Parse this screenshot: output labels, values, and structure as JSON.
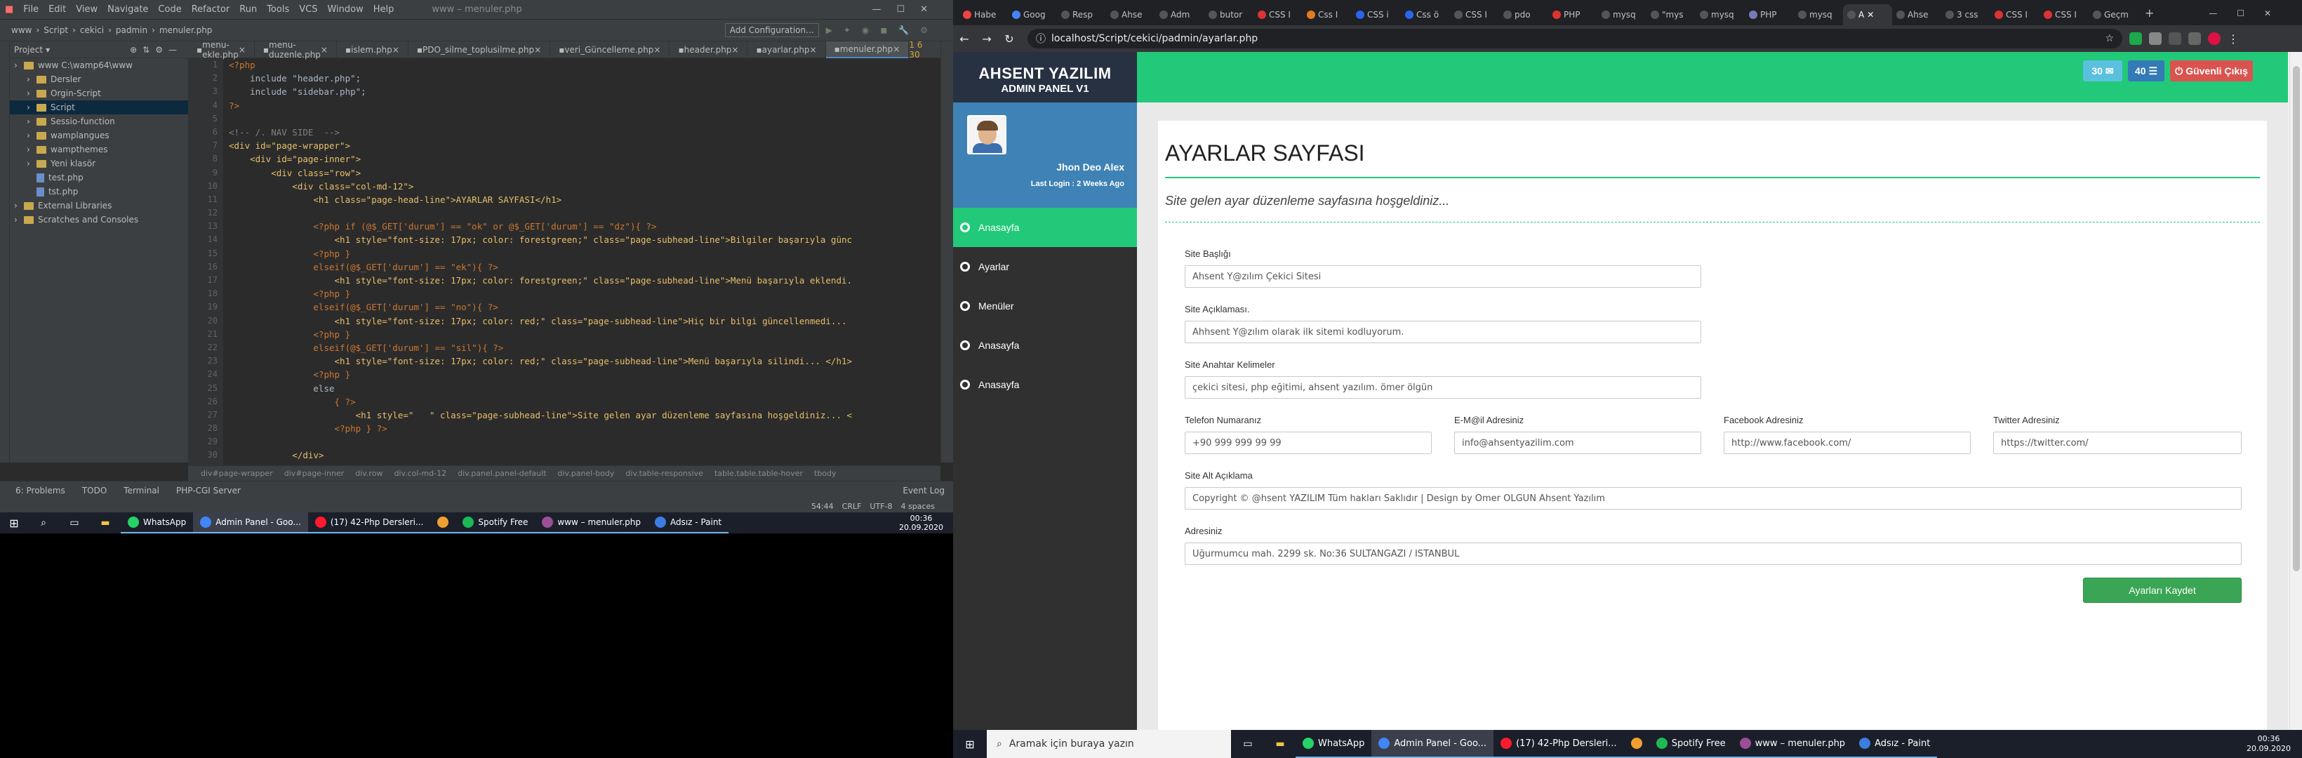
{
  "ide": {
    "menu": [
      "File",
      "Edit",
      "View",
      "Navigate",
      "Code",
      "Refactor",
      "Run",
      "Tools",
      "VCS",
      "Window",
      "Help"
    ],
    "window_title": "www – menuler.php",
    "add_config": "Add Configuration...",
    "breadcrumb": [
      "www",
      "Script",
      "cekici",
      "padmin",
      "menuler.php"
    ],
    "project_label": "Project",
    "project_tree": [
      {
        "label": "www  C:\\wamp64\\www",
        "indent": 0,
        "type": "folder",
        "selected": false
      },
      {
        "label": "Dersler",
        "indent": 1,
        "type": "folder",
        "selected": false
      },
      {
        "label": "Orgin-Script",
        "indent": 1,
        "type": "folder",
        "selected": false
      },
      {
        "label": "Script",
        "indent": 1,
        "type": "folder",
        "selected": true
      },
      {
        "label": "Sessio-function",
        "indent": 1,
        "type": "folder",
        "selected": false
      },
      {
        "label": "wamplangues",
        "indent": 1,
        "type": "folder",
        "selected": false
      },
      {
        "label": "wampthemes",
        "indent": 1,
        "type": "folder",
        "selected": false
      },
      {
        "label": "Yeni klasör",
        "indent": 1,
        "type": "folder",
        "selected": false
      },
      {
        "label": "test.php",
        "indent": 1,
        "type": "file",
        "selected": false
      },
      {
        "label": "tst.php",
        "indent": 1,
        "type": "file",
        "selected": false
      },
      {
        "label": "External Libraries",
        "indent": 0,
        "type": "folder",
        "selected": false
      },
      {
        "label": "Scratches and Consoles",
        "indent": 0,
        "type": "folder",
        "selected": false
      }
    ],
    "tabs": [
      {
        "label": "menu-ekle.php",
        "active": false
      },
      {
        "label": "menu-duzenle.php",
        "active": false
      },
      {
        "label": "islem.php",
        "active": false
      },
      {
        "label": "PDO_silme_toplusilme.php",
        "active": false
      },
      {
        "label": "veri_Güncelleme.php",
        "active": false
      },
      {
        "label": "header.php",
        "active": false
      },
      {
        "label": "ayarlar.php",
        "active": false
      },
      {
        "label": "menuler.php",
        "active": true
      }
    ],
    "inspection_summary": "1  6  30",
    "code_lines": [
      "<?php",
      "    include \"header.php\";",
      "    include \"sidebar.php\";",
      "?>",
      "",
      "<!-- /. NAV SIDE  -->",
      "<div id=\"page-wrapper\">",
      "    <div id=\"page-inner\">",
      "        <div class=\"row\">",
      "            <div class=\"col-md-12\">",
      "                <h1 class=\"page-head-line\">AYARLAR SAYFASI</h1>",
      "",
      "                <?php if (@$_GET['durum'] == \"ok\" or @$_GET['durum'] == \"dz\"){ ?>",
      "                    <h1 style=\"font-size: 17px; color: forestgreen;\" class=\"page-subhead-line\">Bilgiler başarıyla günc",
      "                <?php }",
      "                elseif(@$_GET['durum'] == \"ek\"){ ?>",
      "                    <h1 style=\"font-size: 17px; color: forestgreen;\" class=\"page-subhead-line\">Menü başarıyla eklendi.",
      "                <?php }",
      "                elseif(@$_GET['durum'] == \"no\"){ ?>",
      "                    <h1 style=\"font-size: 17px; color: red;\" class=\"page-subhead-line\">Hiç bir bilgi güncellenmedi...",
      "                <?php }",
      "                elseif(@$_GET['durum'] == \"sil\"){ ?>",
      "                    <h1 style=\"font-size: 17px; color: red;\" class=\"page-subhead-line\">Menü başarıyla silindi... </h1>",
      "                <?php }",
      "                else",
      "                    { ?>",
      "                        <h1 style=\"   \" class=\"page-subhead-line\">Site gelen ayar düzenleme sayfasına hoşgeldiniz... <",
      "                    <?php } ?>",
      "",
      "            </div>"
    ],
    "html_crumbs": [
      "div#page-wrapper",
      "div#page-inner",
      "div.row",
      "div.col-md-12",
      "div.panel.panel-default",
      "div.panel-body",
      "div.table-responsive",
      "table.table.table-hover",
      "tbody"
    ],
    "toolbar": [
      "6: Problems",
      "TODO",
      "Terminal",
      "PHP-CGI Server",
      "Event Log"
    ],
    "status": [
      "54:44",
      "CRLF",
      "UTF-8",
      "4 spaces"
    ]
  },
  "taskbar_left": {
    "apps": [
      {
        "label": "WhatsApp",
        "color": "#25d366",
        "active": false
      },
      {
        "label": "Admin Panel - Goo...",
        "color": "#4285f4",
        "active": true
      },
      {
        "label": "(17) 42-Php Dersleri...",
        "color": "#ff1b2d",
        "active": false
      },
      {
        "label": "",
        "color": "#f0a030",
        "active": false
      },
      {
        "label": "Spotify Free",
        "color": "#1db954",
        "active": false
      },
      {
        "label": "www – menuler.php",
        "color": "#9b4f96",
        "active": false
      },
      {
        "label": "Adsız - Paint",
        "color": "#3d7ce0",
        "active": false
      }
    ],
    "time": "00:36",
    "date": "20.09.2020"
  },
  "browser": {
    "tabs": [
      {
        "label": "Habe",
        "color": "#e44"
      },
      {
        "label": "Goog",
        "color": "#4285f4"
      },
      {
        "label": "Resp",
        "color": "#555"
      },
      {
        "label": "Ahse",
        "color": "#555"
      },
      {
        "label": "Adm",
        "color": "#555"
      },
      {
        "label": "butor",
        "color": "#555"
      },
      {
        "label": "CSS I",
        "color": "#d33"
      },
      {
        "label": "Css I",
        "color": "#e57b20"
      },
      {
        "label": "CSS i",
        "color": "#2965f1"
      },
      {
        "label": "Css ö",
        "color": "#2965f1"
      },
      {
        "label": "CSS I",
        "color": "#555"
      },
      {
        "label": "pdo",
        "color": "#555"
      },
      {
        "label": "PHP",
        "color": "#d33"
      },
      {
        "label": "mysq",
        "color": "#555"
      },
      {
        "label": "\"mys",
        "color": "#555"
      },
      {
        "label": "mysq",
        "color": "#555"
      },
      {
        "label": "PHP",
        "color": "#777bb4"
      },
      {
        "label": "mysq",
        "color": "#555"
      },
      {
        "label": "A",
        "color": "#555",
        "active": true
      },
      {
        "label": "Ahse",
        "color": "#555"
      },
      {
        "label": "3 css",
        "color": "#555"
      },
      {
        "label": "CSS I",
        "color": "#d33"
      },
      {
        "label": "CSS I",
        "color": "#d33"
      },
      {
        "label": "Geçm",
        "color": "#555"
      }
    ],
    "url": "localhost/Script/cekici/padmin/ayarlar.php"
  },
  "admin": {
    "brand": "AHSENT YAZILIM",
    "brand_sub": "ADMIN PANEL V1",
    "header_buttons": {
      "messages": "30",
      "tasks": "40",
      "logout": "Güvenli Çıkış"
    },
    "user_name": "Jhon Deo Alex",
    "last_login": "Last Login : 2 Weeks Ago",
    "menu": [
      {
        "label": "Anasayfa",
        "active": true
      },
      {
        "label": "Ayarlar",
        "active": false
      },
      {
        "label": "Menüler",
        "active": false
      },
      {
        "label": "Anasayfa",
        "active": false
      },
      {
        "label": "Anasayfa",
        "active": false
      }
    ],
    "page_title": "AYARLAR SAYFASI",
    "subhead": "Site gelen ayar düzenleme sayfasına hoşgeldiniz...",
    "form": {
      "site_title": {
        "label": "Site Başlığı",
        "value": "Ahsent Y@zılım Çekici Sitesi"
      },
      "site_desc": {
        "label": "Site Açıklaması.",
        "value": "Ahhsent Y@zılım olarak ilk sitemi kodluyorum."
      },
      "site_keywords": {
        "label": "Site Anahtar Kelimeler",
        "value": "çekici sitesi, php eğitimi, ahsent yazılım. ömer ölgün"
      },
      "phone": {
        "label": "Telefon Numaranız",
        "value": "+90 999 999 99 99"
      },
      "email": {
        "label": "E-M@il Adresiniz",
        "value": "info@ahsentyazilim.com"
      },
      "facebook": {
        "label": "Facebook Adresiniz",
        "value": "http://www.facebook.com/"
      },
      "twitter": {
        "label": "Twitter Adresiniz",
        "value": "https://twitter.com/"
      },
      "footer_desc": {
        "label": "Site Alt Açıklama",
        "value": "Copyright © @hsent YAZILIM Tüm hakları Saklıdır | Design by Ömer OLGÜN Ahsent Yazılım"
      },
      "address": {
        "label": "Adresiniz",
        "value": "Uğurmumcu mah. 2299 sk. No:36 SULTANGAZİ / İSTANBUL"
      },
      "save_label": "Ayarları Kaydet"
    }
  },
  "taskbar_right": {
    "search_placeholder": "Aramak için buraya yazın",
    "apps": [
      {
        "label": "WhatsApp",
        "color": "#25d366",
        "active": false
      },
      {
        "label": "Admin Panel - Goo...",
        "color": "#4285f4",
        "active": true
      },
      {
        "label": "(17) 42-Php Dersleri...",
        "color": "#ff1b2d",
        "active": false
      },
      {
        "label": "",
        "color": "#f0a030",
        "active": false
      },
      {
        "label": "Spotify Free",
        "color": "#1db954",
        "active": false
      },
      {
        "label": "www – menuler.php",
        "color": "#9b4f96",
        "active": false
      },
      {
        "label": "Adsız - Paint",
        "color": "#3d7ce0",
        "active": false
      }
    ],
    "time": "00:36",
    "date": "20.09.2020"
  },
  "colors": {
    "accent": "#22c979",
    "sidebar": "#303030",
    "user_panel": "#3f82b5",
    "save": "#3aa655"
  }
}
